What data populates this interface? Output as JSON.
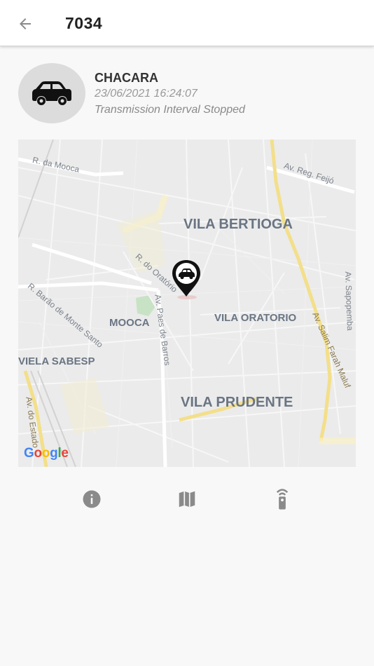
{
  "header": {
    "title": "7034",
    "back_icon": "arrow-left-icon"
  },
  "vehicle": {
    "icon": "car-icon",
    "name": "CHACARA",
    "timestamp": "23/06/2021 16:24:07",
    "status": "Transmission Interval Stopped"
  },
  "map": {
    "neighborhoods": [
      "VILA BERTIOGA",
      "VILA ORATORIO",
      "MOOCA",
      "VILA PRUDENTE",
      "VIELA SABESP"
    ],
    "streets": [
      "R. da Mooca",
      "Av. Reg. Feijó",
      "R. do Oratório",
      "R. Barão de Monte Santo",
      "Av. Paes de Barros",
      "Av. Sapopemba",
      "Av. Salim Farah Maluf",
      "Av. do Estado"
    ],
    "attribution": "Google",
    "marker_icon": "car-marker-icon"
  },
  "actions": [
    {
      "name": "info",
      "icon": "info-icon"
    },
    {
      "name": "map",
      "icon": "map-icon"
    },
    {
      "name": "remote",
      "icon": "remote-control-icon"
    }
  ],
  "colors": {
    "accent": "#222222",
    "avatar_bg": "#dcdcdc",
    "icon_gray": "#8a8a8a",
    "highway": "#f3df8a"
  }
}
